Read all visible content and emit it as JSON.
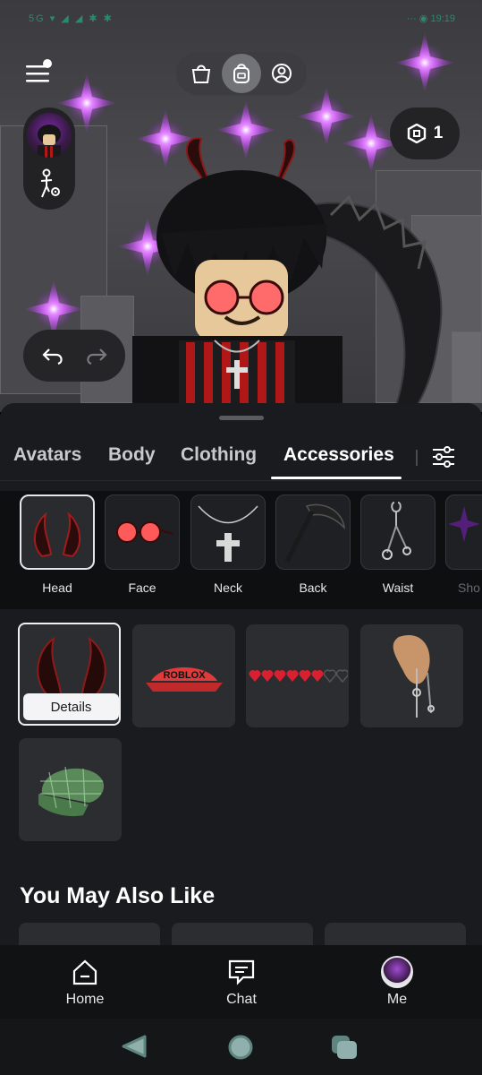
{
  "status_bar": {
    "left": "5G ▾ ◢ ◢ ✱ ✱",
    "right": "··· ◉ 19:19"
  },
  "header": {
    "menu_icon": "hamburger-icon",
    "switch_items": [
      "shop-bag-icon",
      "backpack-icon",
      "avatar-profile-icon"
    ],
    "active_switch": 1
  },
  "robux": {
    "icon": "robux-icon",
    "amount": "1"
  },
  "tabs": [
    {
      "label": "Avatars"
    },
    {
      "label": "Body"
    },
    {
      "label": "Clothing"
    },
    {
      "label": "Accessories"
    }
  ],
  "active_tab": "Accessories",
  "subcategories": [
    {
      "label": "Head"
    },
    {
      "label": "Face"
    },
    {
      "label": "Neck"
    },
    {
      "label": "Back"
    },
    {
      "label": "Waist"
    },
    {
      "label": "Sho"
    }
  ],
  "active_subcategory": "Head",
  "items": [
    {
      "name": "horns",
      "selected": true
    },
    {
      "name": "roblox-visor",
      "selected": false
    },
    {
      "name": "hearts-accessory",
      "selected": false
    },
    {
      "name": "earring",
      "selected": false
    },
    {
      "name": "green-plaid-cap",
      "selected": false
    }
  ],
  "details_label": "Details",
  "ymal_title": "You May Also Like",
  "bottom_nav": [
    {
      "label": "Home",
      "icon": "home-icon"
    },
    {
      "label": "Chat",
      "icon": "chat-icon"
    },
    {
      "label": "Me",
      "icon": "avatar-icon"
    }
  ],
  "colors": {
    "accent_purple": "#b02ee0",
    "sheet_bg": "#1a1b1e",
    "stage_bg": "#46464b"
  }
}
